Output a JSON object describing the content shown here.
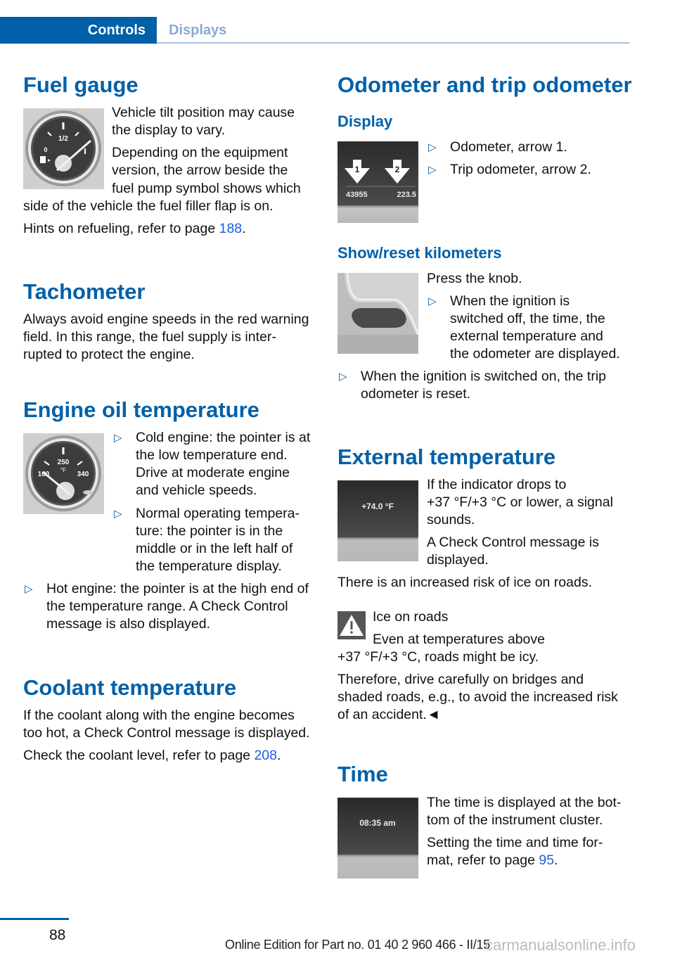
{
  "header": {
    "tabs": [
      {
        "label": "Controls",
        "active": true
      },
      {
        "label": "Displays",
        "active": false
      }
    ]
  },
  "left": {
    "fuel_gauge": {
      "title": "Fuel gauge",
      "image": {
        "labels": [
          "0",
          "1/2",
          "1"
        ],
        "icon": "fuel-pump-icon"
      },
      "p1": [
        "Vehicle tilt position may cause",
        "the display to vary."
      ],
      "p2": [
        "Depending on the equipment",
        "version, the arrow beside the",
        "fuel pump symbol shows which",
        "side of the vehicle the fuel filler flap is on."
      ],
      "p3_prefix": "Hints on refueling, refer to page ",
      "p3_link": "188",
      "p3_suffix": "."
    },
    "tachometer": {
      "title": "Tachometer",
      "text": [
        "Always avoid engine speeds in the red warning",
        "field. In this range, the fuel supply is inter-",
        "rupted to protect the engine."
      ]
    },
    "oil_temp": {
      "title": "Engine oil temperature",
      "image": {
        "labels": [
          "160",
          "250",
          "°F",
          "340"
        ]
      },
      "bullets": [
        [
          "Cold engine: the pointer is at",
          "the low temperature end.",
          "Drive at moderate engine",
          "and vehicle speeds."
        ],
        [
          "Normal operating tempera-",
          "ture: the pointer is in the",
          "middle or in the left half of",
          "the temperature display."
        ],
        [
          "Hot engine: the pointer is at the high end of",
          "the temperature range. A Check Control",
          "message is also displayed."
        ]
      ],
      "bullet_glyph": "▷"
    },
    "coolant": {
      "title": "Coolant temperature",
      "text": [
        "If the coolant along with the engine becomes",
        "too hot, a Check Control message is displayed."
      ],
      "p2_prefix": "Check the coolant level, refer to page ",
      "p2_link": "208",
      "p2_suffix": "."
    }
  },
  "right": {
    "odometer": {
      "title": "Odometer and trip odometer",
      "subtitle": "Display",
      "image": {
        "arrow1": "1",
        "arrow2": "2",
        "odo_value": "43955",
        "trip_value": "223.5"
      },
      "bullets": [
        "Odometer, arrow 1.",
        "Trip odometer, arrow 2."
      ]
    },
    "show_reset": {
      "title": "Show/reset kilometers",
      "intro": "Press the knob.",
      "bullets": [
        [
          "When the ignition is",
          "switched off, the time, the",
          "external temperature and",
          "the odometer are displayed."
        ],
        [
          "When the ignition is switched on, the trip",
          "odometer is reset."
        ]
      ]
    },
    "external_temp": {
      "title": "External temperature",
      "image": {
        "reading": "+74.0 °F"
      },
      "p1": [
        "If the indicator drops to",
        "+37 °F/+3 °C or lower, a signal",
        "sounds."
      ],
      "p2": [
        "A Check Control message is",
        "displayed."
      ],
      "p3": "There is an increased risk of ice on roads.",
      "warning": {
        "icon": "warning-triangle-icon",
        "title": "Ice on roads",
        "lines": [
          "Even at temperatures above",
          "+37 °F/+3 °C, roads might be icy."
        ],
        "p": [
          "Therefore, drive carefully on bridges and",
          "shaded roads, e.g., to avoid the increased risk",
          "of an accident.◄"
        ]
      }
    },
    "time": {
      "title": "Time",
      "image": {
        "reading": "08:35 am"
      },
      "p1": [
        "The time is displayed at the bot-",
        "tom of the instrument cluster."
      ],
      "p2_line1": "Setting the time and time for-",
      "p2_prefix": "mat, refer to page ",
      "p2_link": "95",
      "p2_suffix": "."
    }
  },
  "footer": {
    "page_number": "88",
    "edition": "Online Edition for Part no. 01 40 2 960 466 - II/15",
    "watermark": "carmanualsonline.info"
  }
}
